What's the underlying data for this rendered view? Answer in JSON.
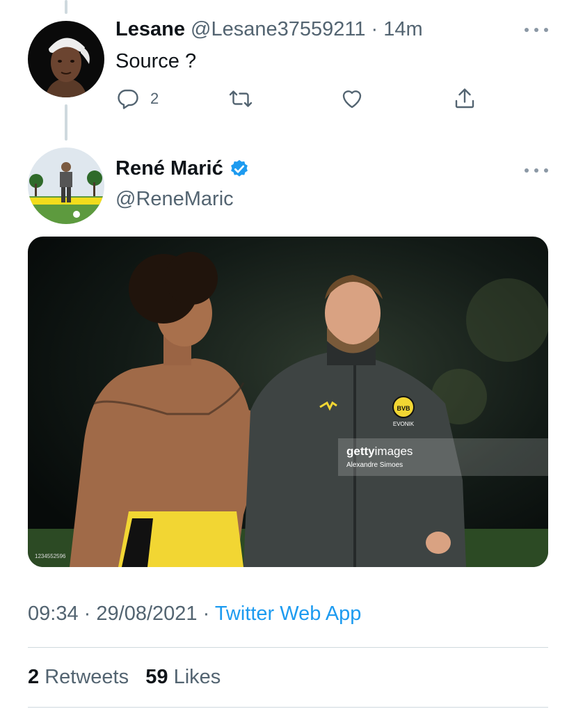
{
  "reply_tweet": {
    "name": "Lesane",
    "handle": "@Lesane37559211",
    "separator": "·",
    "time": "14m",
    "text": "Source ?",
    "reply_count": "2",
    "icons": [
      "reply-icon",
      "retweet-icon",
      "like-icon",
      "share-icon",
      "more-icon"
    ]
  },
  "main_tweet": {
    "name": "René Marić",
    "handle": "@ReneMaric",
    "verified": true,
    "media": {
      "watermark_brand_bold": "getty",
      "watermark_brand_light": "images",
      "watermark_credit": "Alexandre Simoes",
      "image_id": "1234552596",
      "badge_text": "BVB",
      "sponsor_text": "EVONIK"
    },
    "timestamp": {
      "time": "09:34",
      "separator": "·",
      "date": "29/08/2021",
      "source": "Twitter Web App"
    },
    "stats": {
      "retweets_count": "2",
      "retweets_label": "Retweets",
      "likes_count": "59",
      "likes_label": "Likes"
    }
  },
  "colors": {
    "accent": "#1d9bf0",
    "secondary_text": "#536471",
    "primary_text": "#0f1419",
    "divider": "#cfd9de"
  }
}
